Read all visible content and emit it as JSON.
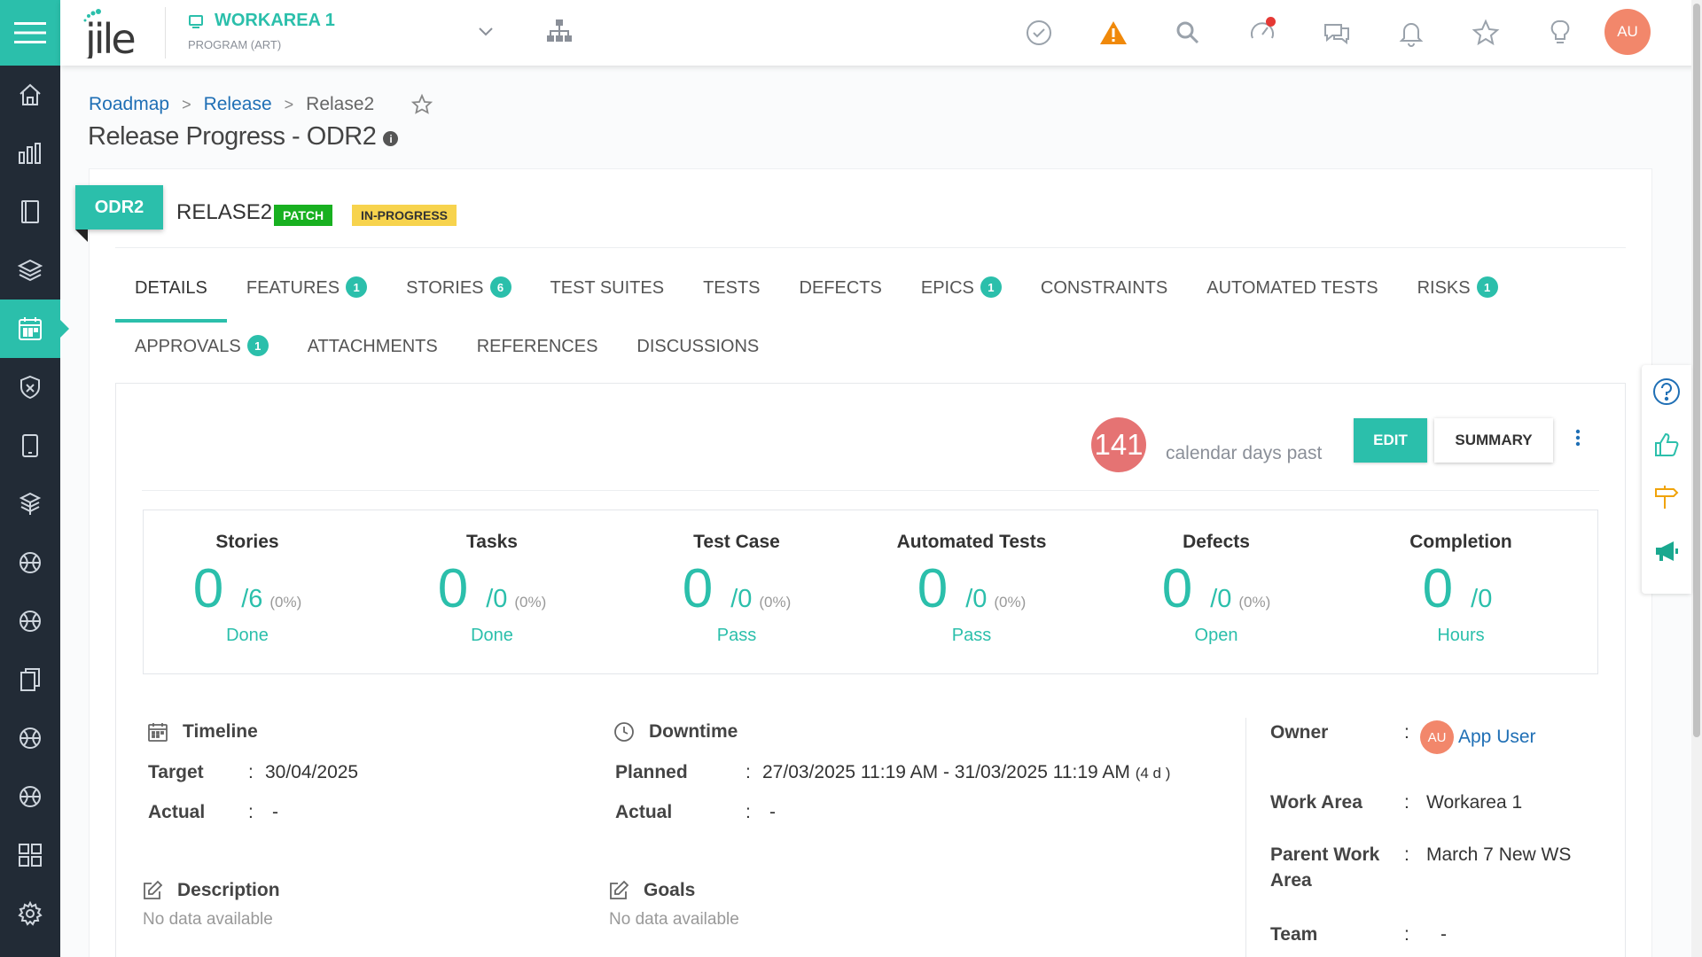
{
  "header": {
    "logo_text": "jile",
    "workspace_name": "WORKAREA 1",
    "workspace_type": "PROGRAM (ART)",
    "avatar_initials": "AU"
  },
  "breadcrumb": {
    "items": [
      "Roadmap",
      "Release",
      "Relase2"
    ],
    "separator": ">"
  },
  "page_title": "Release Progress - ODR2",
  "release": {
    "code": "ODR2",
    "name": "RELASE2",
    "tags": [
      "PATCH",
      "IN-PROGRESS"
    ]
  },
  "tabs": {
    "row1": [
      {
        "label": "DETAILS",
        "badge": ""
      },
      {
        "label": "FEATURES",
        "badge": "1"
      },
      {
        "label": "STORIES",
        "badge": "6"
      },
      {
        "label": "TEST SUITES",
        "badge": ""
      },
      {
        "label": "TESTS",
        "badge": ""
      },
      {
        "label": "DEFECTS",
        "badge": ""
      },
      {
        "label": "EPICS",
        "badge": "1"
      },
      {
        "label": "CONSTRAINTS",
        "badge": ""
      },
      {
        "label": "AUTOMATED TESTS",
        "badge": ""
      },
      {
        "label": "RISKS",
        "badge": "1"
      }
    ],
    "row2": [
      {
        "label": "APPROVALS",
        "badge": "1"
      },
      {
        "label": "ATTACHMENTS",
        "badge": ""
      },
      {
        "label": "REFERENCES",
        "badge": ""
      },
      {
        "label": "DISCUSSIONS",
        "badge": ""
      }
    ]
  },
  "days": {
    "count": "141",
    "label": "calendar days past"
  },
  "buttons": {
    "edit": "EDIT",
    "summary": "SUMMARY"
  },
  "stats": [
    {
      "label": "Stories",
      "value": "0",
      "total": "/6",
      "pct": "(0%)",
      "unit": "Done"
    },
    {
      "label": "Tasks",
      "value": "0",
      "total": "/0",
      "pct": "(0%)",
      "unit": "Done"
    },
    {
      "label": "Test Case",
      "value": "0",
      "total": "/0",
      "pct": "(0%)",
      "unit": "Pass"
    },
    {
      "label": "Automated Tests",
      "value": "0",
      "total": "/0",
      "pct": "(0%)",
      "unit": "Pass"
    },
    {
      "label": "Defects",
      "value": "0",
      "total": "/0",
      "pct": "(0%)",
      "unit": "Open"
    },
    {
      "label": "Completion",
      "value": "0",
      "total": "/0",
      "pct": "",
      "unit": "Hours"
    }
  ],
  "timeline": {
    "title": "Timeline",
    "target_label": "Target",
    "target_value": "30/04/2025",
    "actual_label": "Actual",
    "actual_value": "-"
  },
  "downtime": {
    "title": "Downtime",
    "planned_label": "Planned",
    "planned_value": "27/03/2025 11:19 AM - 31/03/2025 11:19 AM",
    "planned_duration": "(4 d )",
    "actual_label": "Actual",
    "actual_value": "-"
  },
  "description": {
    "title": "Description",
    "value": "No data available"
  },
  "goals": {
    "title": "Goals",
    "value": "No data available"
  },
  "info": {
    "owner_label": "Owner",
    "owner_initials": "AU",
    "owner_name": "App User",
    "workarea_label": "Work Area",
    "workarea_value": "Workarea 1",
    "parent_label_1": "Parent Work",
    "parent_label_2": "Area",
    "parent_value": "March 7 New WS",
    "team_label": "Team",
    "team_value": "-",
    "colon": ":"
  },
  "colors": {
    "accent": "#2bbfab",
    "sidebar": "#222b36",
    "link": "#1f6fb5",
    "days": "#e57373"
  }
}
